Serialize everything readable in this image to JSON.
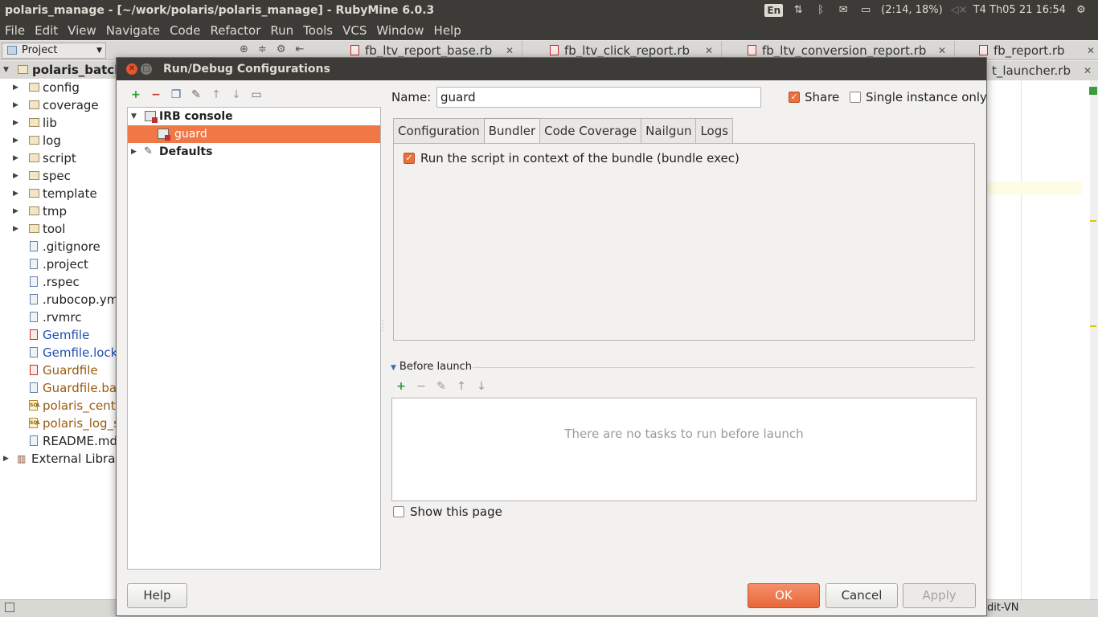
{
  "system_bar": {
    "window_title": "polaris_manage - [~/work/polaris/polaris_manage] - RubyMine 6.0.3",
    "lang": "En",
    "battery": "(2:14, 18%)",
    "datetime": "T4 Th05 21  16:54"
  },
  "menu": [
    "File",
    "Edit",
    "View",
    "Navigate",
    "Code",
    "Refactor",
    "Run",
    "Tools",
    "VCS",
    "Window",
    "Help"
  ],
  "project_combo": "Project",
  "editor_tabs": [
    "fb_ltv_report_base.rb",
    "fb_ltv_click_report.rb",
    "fb_ltv_conversion_report.rb",
    "fb_report.rb"
  ],
  "editor_tab_second_row": "t_launcher.rb",
  "project_tree": {
    "root": "polaris_batch",
    "folders": [
      "config",
      "coverage",
      "lib",
      "log",
      "script",
      "spec",
      "template",
      "tmp",
      "tool"
    ],
    "files": [
      ".gitignore",
      ".project",
      ".rspec",
      ".rubocop.yml",
      ".rvmrc",
      "Gemfile",
      "Gemfile.lock",
      "Guardfile",
      "Guardfile.bak",
      "polaris_centr",
      "polaris_log_st",
      "README.md"
    ],
    "external": "External Librari"
  },
  "status_bar": {
    "encoding": "dit-VN"
  },
  "dialog": {
    "title": "Run/Debug Configurations",
    "tree": {
      "group": "IRB console",
      "selected": "guard",
      "defaults": "Defaults"
    },
    "name_label": "Name:",
    "name_value": "guard",
    "share_label": "Share",
    "share_checked": true,
    "single_instance_label": "Single instance only",
    "single_instance_checked": false,
    "tabs": [
      "Configuration",
      "Bundler",
      "Code Coverage",
      "Nailgun",
      "Logs"
    ],
    "active_tab": "Bundler",
    "bundler_option": "Run the script in context of the bundle (bundle exec)",
    "bundler_option_checked": true,
    "before_launch_label": "Before launch",
    "before_launch_empty": "There are no tasks to run before launch",
    "show_page_label": "Show this page",
    "show_page_checked": false,
    "buttons": {
      "help": "Help",
      "ok": "OK",
      "cancel": "Cancel",
      "apply": "Apply"
    }
  }
}
